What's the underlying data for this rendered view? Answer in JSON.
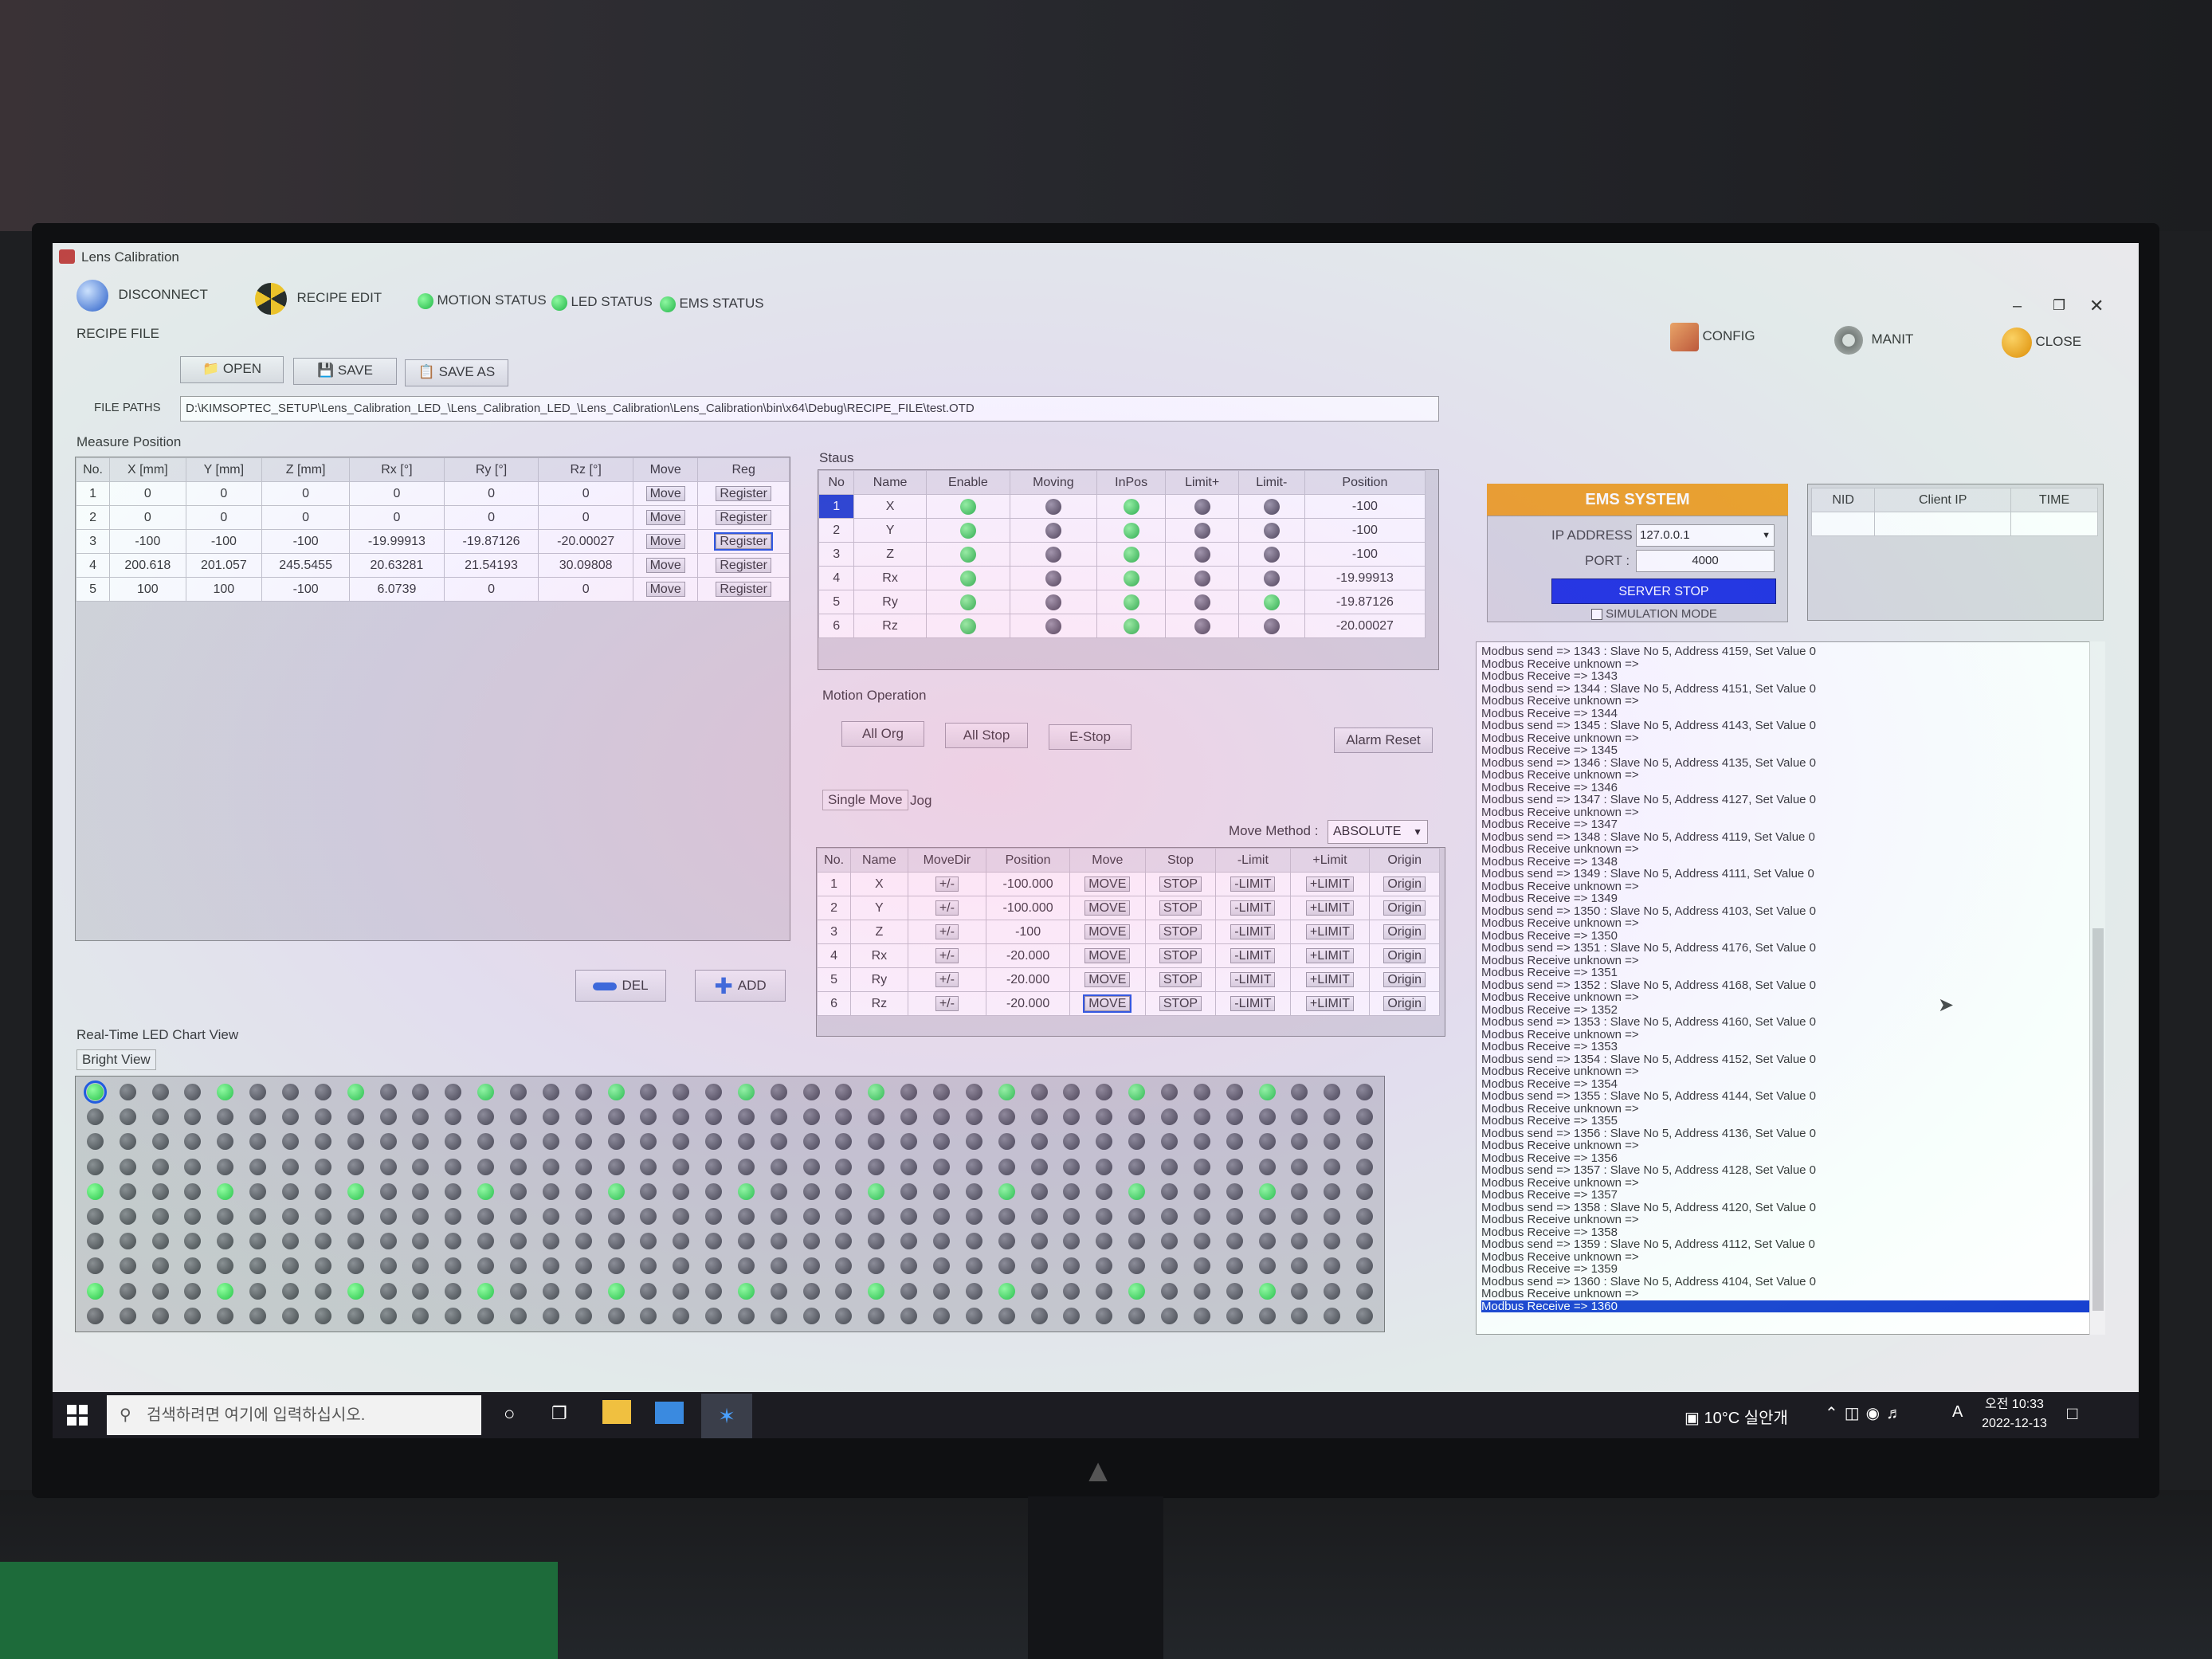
{
  "window": {
    "title": "Lens Calibration"
  },
  "toolbar": {
    "disconnect": "DISCONNECT",
    "recipe_edit": "RECIPE EDIT",
    "motion_status": "MOTION STATUS",
    "led_status": "LED STATUS",
    "ems_status": "EMS STATUS",
    "config": "CONFIG",
    "manit": "MANIT",
    "close": "CLOSE"
  },
  "recipe": {
    "section": "RECIPE FILE",
    "open": "OPEN",
    "save": "SAVE",
    "save_as": "SAVE AS",
    "file_paths_label": "FILE PATHS",
    "file_path": "D:\\KIMSOPTEC_SETUP\\Lens_Calibration_LED_\\Lens_Calibration_LED_\\Lens_Calibration\\Lens_Calibration\\bin\\x64\\Debug\\RECIPE_FILE\\test.OTD"
  },
  "measure": {
    "title": "Measure Position",
    "headers": [
      "No.",
      "X [mm]",
      "Y [mm]",
      "Z [mm]",
      "Rx [°]",
      "Ry [°]",
      "Rz [°]",
      "Move",
      "Reg"
    ],
    "rows": [
      [
        "1",
        "0",
        "0",
        "0",
        "0",
        "0",
        "0"
      ],
      [
        "2",
        "0",
        "0",
        "0",
        "0",
        "0",
        "0"
      ],
      [
        "3",
        "-100",
        "-100",
        "-100",
        "-19.99913",
        "-19.87126",
        "-20.00027"
      ],
      [
        "4",
        "200.618",
        "201.057",
        "245.5455",
        "20.63281",
        "21.54193",
        "30.09808"
      ],
      [
        "5",
        "100",
        "100",
        "-100",
        "6.0739",
        "0",
        "0"
      ]
    ],
    "move_label": "Move",
    "reg_label": "Register",
    "del": "DEL",
    "add": "ADD"
  },
  "status": {
    "title": "Staus",
    "headers": [
      "No",
      "Name",
      "Enable",
      "Moving",
      "InPos",
      "Limit+",
      "Limit-",
      "Position"
    ],
    "rows": [
      {
        "no": "1",
        "name": "X",
        "enable": 1,
        "moving": 0,
        "inpos": 1,
        "limp": 0,
        "limm": 0,
        "pos": "-100"
      },
      {
        "no": "2",
        "name": "Y",
        "enable": 1,
        "moving": 0,
        "inpos": 1,
        "limp": 0,
        "limm": 0,
        "pos": "-100"
      },
      {
        "no": "3",
        "name": "Z",
        "enable": 1,
        "moving": 0,
        "inpos": 1,
        "limp": 0,
        "limm": 0,
        "pos": "-100"
      },
      {
        "no": "4",
        "name": "Rx",
        "enable": 1,
        "moving": 0,
        "inpos": 1,
        "limp": 0,
        "limm": 0,
        "pos": "-19.99913"
      },
      {
        "no": "5",
        "name": "Ry",
        "enable": 1,
        "moving": 0,
        "inpos": 1,
        "limp": 0,
        "limm": 1,
        "pos": "-19.87126"
      },
      {
        "no": "6",
        "name": "Rz",
        "enable": 1,
        "moving": 0,
        "inpos": 1,
        "limp": 0,
        "limm": 0,
        "pos": "-20.00027"
      }
    ]
  },
  "motion_op": {
    "title": "Motion Operation",
    "all_org": "All Org",
    "all_stop": "All Stop",
    "e_stop": "E-Stop",
    "alarm_reset": "Alarm Reset"
  },
  "single": {
    "tab_single": "Single Move",
    "tab_jog": "Jog",
    "move_method_label": "Move Method :",
    "move_method": "ABSOLUTE",
    "headers": [
      "No.",
      "Name",
      "MoveDir",
      "Position",
      "Move",
      "Stop",
      "-Limit",
      "+Limit",
      "Origin"
    ],
    "rows": [
      [
        "1",
        "X",
        "-100.000"
      ],
      [
        "2",
        "Y",
        "-100.000"
      ],
      [
        "3",
        "Z",
        "-100"
      ],
      [
        "4",
        "Rx",
        "-20.000"
      ],
      [
        "5",
        "Ry",
        "-20.000"
      ],
      [
        "6",
        "Rz",
        "-20.000"
      ]
    ],
    "dir": "+/-",
    "move": "MOVE",
    "stop": "STOP",
    "mlimit": "-LIMIT",
    "plimit": "+LIMIT",
    "origin": "Origin"
  },
  "ems": {
    "title": "EMS SYSTEM",
    "ip_label": "IP ADDRESS",
    "ip": "127.0.0.1",
    "port_label": "PORT :",
    "port": "4000",
    "server_stop": "SERVER STOP",
    "sim_mode": "SIMULATION MODE"
  },
  "clients": {
    "headers": [
      "NID",
      "Client IP",
      "TIME"
    ]
  },
  "log": [
    "Modbus send => 1343 : Slave No 5, Address 4159, Set Value 0",
    "Modbus Receive unknown =>",
    "Modbus Receive => 1343",
    "Modbus send => 1344 : Slave No 5, Address 4151, Set Value 0",
    "Modbus Receive unknown =>",
    "Modbus Receive => 1344",
    "Modbus send => 1345 : Slave No 5, Address 4143, Set Value 0",
    "Modbus Receive unknown =>",
    "Modbus Receive => 1345",
    "Modbus send => 1346 : Slave No 5, Address 4135, Set Value 0",
    "Modbus Receive unknown =>",
    "Modbus Receive => 1346",
    "Modbus send => 1347 : Slave No 5, Address 4127, Set Value 0",
    "Modbus Receive unknown =>",
    "Modbus Receive => 1347",
    "Modbus send => 1348 : Slave No 5, Address 4119, Set Value 0",
    "Modbus Receive unknown =>",
    "Modbus Receive => 1348",
    "Modbus send => 1349 : Slave No 5, Address 4111, Set Value 0",
    "Modbus Receive unknown =>",
    "Modbus Receive => 1349",
    "Modbus send => 1350 : Slave No 5, Address 4103, Set Value 0",
    "Modbus Receive unknown =>",
    "Modbus Receive => 1350",
    "Modbus send => 1351 : Slave No 5, Address 4176, Set Value 0",
    "Modbus Receive unknown =>",
    "Modbus Receive => 1351",
    "Modbus send => 1352 : Slave No 5, Address 4168, Set Value 0",
    "Modbus Receive unknown =>",
    "Modbus Receive => 1352",
    "Modbus send => 1353 : Slave No 5, Address 4160, Set Value 0",
    "Modbus Receive unknown =>",
    "Modbus Receive => 1353",
    "Modbus send => 1354 : Slave No 5, Address 4152, Set Value 0",
    "Modbus Receive unknown =>",
    "Modbus Receive => 1354",
    "Modbus send => 1355 : Slave No 5, Address 4144, Set Value 0",
    "Modbus Receive unknown =>",
    "Modbus Receive => 1355",
    "Modbus send => 1356 : Slave No 5, Address 4136, Set Value 0",
    "Modbus Receive unknown =>",
    "Modbus Receive => 1356",
    "Modbus send => 1357 : Slave No 5, Address 4128, Set Value 0",
    "Modbus Receive unknown =>",
    "Modbus Receive => 1357",
    "Modbus send => 1358 : Slave No 5, Address 4120, Set Value 0",
    "Modbus Receive unknown =>",
    "Modbus Receive => 1358",
    "Modbus send => 1359 : Slave No 5, Address 4112, Set Value 0",
    "Modbus Receive unknown =>",
    "Modbus Receive => 1359",
    "Modbus send => 1360 : Slave No 5, Address 4104, Set Value 0",
    "Modbus Receive unknown =>",
    "Modbus Receive => 1360"
  ],
  "led_chart": {
    "title": "Real-Time LED Chart View",
    "tab": "Bright View",
    "rows": 10,
    "cols": 40,
    "lit": [
      [
        0,
        4,
        8,
        12,
        16,
        20,
        24,
        28,
        32,
        36
      ],
      [],
      [],
      [],
      [
        0,
        4,
        8,
        12,
        16,
        20,
        24,
        28,
        32,
        36
      ],
      [],
      [],
      [],
      [
        0,
        4,
        8,
        12,
        16,
        20,
        24,
        28,
        32,
        36
      ],
      []
    ],
    "selected": [
      0,
      0
    ]
  },
  "taskbar": {
    "search": "검색하려면 여기에 입력하십시오.",
    "weather": "10°C 실안개",
    "time": "오전 10:33",
    "date": "2022-12-13",
    "lang": "A"
  },
  "colors": {
    "ems_header": "#f0a020",
    "server_stop": "#1a2fe0",
    "led_on": "#20c040",
    "selection": "#1740d0"
  }
}
